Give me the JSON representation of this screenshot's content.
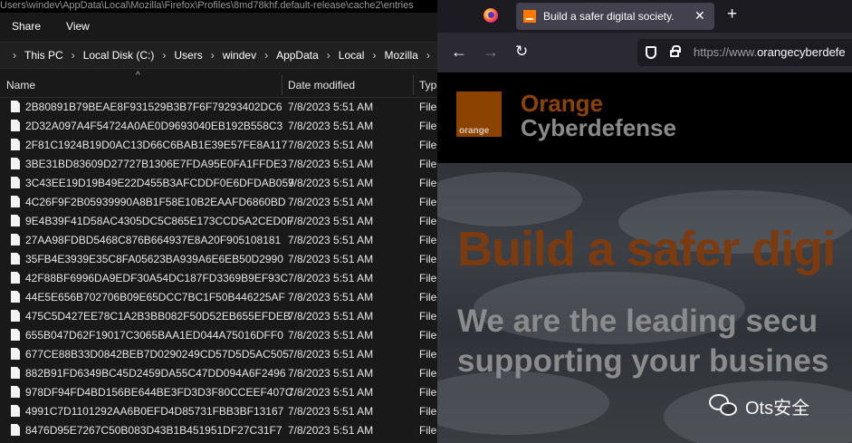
{
  "explorer": {
    "title_path": "Users\\windev\\AppData\\Local\\Mozilla\\Firefox\\Profiles\\8md78khf.default-release\\cache2\\entries",
    "ribbon": [
      "Share",
      "View"
    ],
    "breadcrumb": [
      "This PC",
      "Local Disk (C:)",
      "Users",
      "windev",
      "AppData",
      "Local",
      "Mozilla"
    ],
    "columns": {
      "name": "Name",
      "date": "Date modified",
      "type": "Typ"
    },
    "files": [
      {
        "name": "2B80891B79BEAE8F931529B3B7F6F79293402DC6",
        "date": "7/8/2023 5:51 AM",
        "type": "File"
      },
      {
        "name": "2D32A097A4F54724A0AE0D9693040EB192B558C3",
        "date": "7/8/2023 5:51 AM",
        "type": "File"
      },
      {
        "name": "2F81C1924B19D0AC13D66C6BAB1E39E57FE8A117",
        "date": "7/8/2023 5:51 AM",
        "type": "File"
      },
      {
        "name": "3BE31BD83609D27727B1306E7FDA95E0FA1FFDE3",
        "date": "7/8/2023 5:51 AM",
        "type": "File"
      },
      {
        "name": "3C43EE19D19B49E22D455B3AFCDDF0E6DFDAB059",
        "date": "7/8/2023 5:51 AM",
        "type": "File"
      },
      {
        "name": "4C26F9F2B05939990A8B1F58E10B2EAAFD6860BD",
        "date": "7/8/2023 5:51 AM",
        "type": "File"
      },
      {
        "name": "9E4B39F41D58AC4305DC5C865E173CCD5A2CED0F",
        "date": "7/8/2023 5:51 AM",
        "type": "File"
      },
      {
        "name": "27AA98FDBD5468C876B664937E8A20F905108181",
        "date": "7/8/2023 5:51 AM",
        "type": "File"
      },
      {
        "name": "35FB4E3939E35C8FA05623BA939A6E6EB50D2990",
        "date": "7/8/2023 5:51 AM",
        "type": "File"
      },
      {
        "name": "42F88BF6996DA9EDF30A54DC187FD3369B9EF93C",
        "date": "7/8/2023 5:51 AM",
        "type": "File"
      },
      {
        "name": "44E5E656B702706B09E65DCC7BC1F50B446225AF",
        "date": "7/8/2023 5:51 AM",
        "type": "File"
      },
      {
        "name": "475C5D427EE78C1A2B3BB082F50D52EB655EFDEB",
        "date": "7/8/2023 5:51 AM",
        "type": "File"
      },
      {
        "name": "655B047D62F19017C3065BAA1ED044A75016DFF0",
        "date": "7/8/2023 5:51 AM",
        "type": "File"
      },
      {
        "name": "677CE88B33D0842BEB7D0290249CD57D5D5AC505",
        "date": "7/8/2023 5:51 AM",
        "type": "File"
      },
      {
        "name": "882B91FD6349BC45D2459DA55C47DD094A6F2496",
        "date": "7/8/2023 5:51 AM",
        "type": "File"
      },
      {
        "name": "978DF94FD4BD156BE644BE3FD3D3F80CCEEF407C",
        "date": "7/8/2023 5:51 AM",
        "type": "File"
      },
      {
        "name": "4991C7D1101292AA6B0EFD4D85731FBB3BF13167",
        "date": "7/8/2023 5:51 AM",
        "type": "File"
      },
      {
        "name": "8476D95E7267C50B083D43B1B451951DF27C31F7",
        "date": "7/8/2023 5:51 AM",
        "type": "File"
      }
    ]
  },
  "browser": {
    "tab_title": "Build a safer digital society.",
    "tab_close": "✕",
    "new_tab": "+",
    "url_prefix": "https://www.",
    "url_host": "orangecyberdefe",
    "icons": {
      "back": "back-arrow-icon",
      "forward": "forward-arrow-icon",
      "reload": "reload-icon",
      "shield": "shield-icon",
      "lock": "lock-icon"
    },
    "accent": "#ff7900"
  },
  "site": {
    "logo_word": "orange",
    "brand_line1": "Orange",
    "brand_line2": "Cyberdefense",
    "hero_title": "Build a safer digi",
    "hero_sub1": "We are the leading secu",
    "hero_sub2": "supporting your busines"
  },
  "watermark": {
    "text": "Ots安全"
  }
}
